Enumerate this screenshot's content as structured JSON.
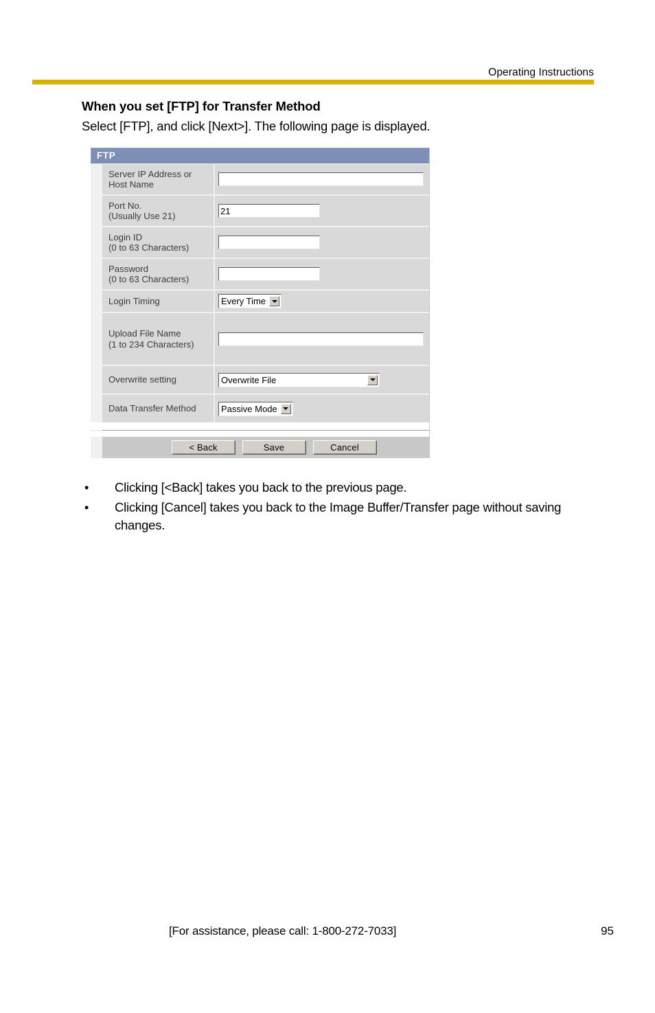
{
  "header": {
    "running_head": "Operating Instructions",
    "rule_color": "#D5B300"
  },
  "section": {
    "title": "When you set [FTP] for Transfer Method",
    "intro": "Select [FTP], and click [Next>]. The following page is displayed."
  },
  "panel": {
    "title": "FTP",
    "title_bg": "#7d8fb6",
    "rows": [
      {
        "label_line1": "Server IP Address or",
        "label_line2": "Host Name",
        "control": "text",
        "value": ""
      },
      {
        "label_line1": "Port No.",
        "label_line2": "(Usually Use 21)",
        "control": "text",
        "value": "21"
      },
      {
        "label_line1": "Login ID",
        "label_line2": "(0 to 63 Characters)",
        "control": "text",
        "value": ""
      },
      {
        "label_line1": "Password",
        "label_line2": "(0 to 63 Characters)",
        "control": "text",
        "value": ""
      },
      {
        "label_line1": "Login Timing",
        "label_line2": "",
        "control": "select",
        "value": "Every Time"
      },
      {
        "label_line1": "Upload File Name",
        "label_line2": "(1 to 234 Characters)",
        "control": "text",
        "value": ""
      },
      {
        "label_line1": "Overwrite setting",
        "label_line2": "",
        "control": "select",
        "value": "Overwrite File"
      },
      {
        "label_line1": "Data Transfer Method",
        "label_line2": "",
        "control": "select",
        "value": "Passive Mode"
      }
    ],
    "buttons": {
      "back": "< Back",
      "save": "Save",
      "cancel": "Cancel"
    }
  },
  "notes": [
    "Clicking [<Back] takes you back to the previous page.",
    "Clicking [Cancel] takes you back to the Image Buffer/Transfer page without saving changes.",
    "•"
  ],
  "bullet_glyph": "•",
  "footer": {
    "assistance": "[For assistance, please call: 1-800-272-7033]",
    "page_number": "95"
  }
}
